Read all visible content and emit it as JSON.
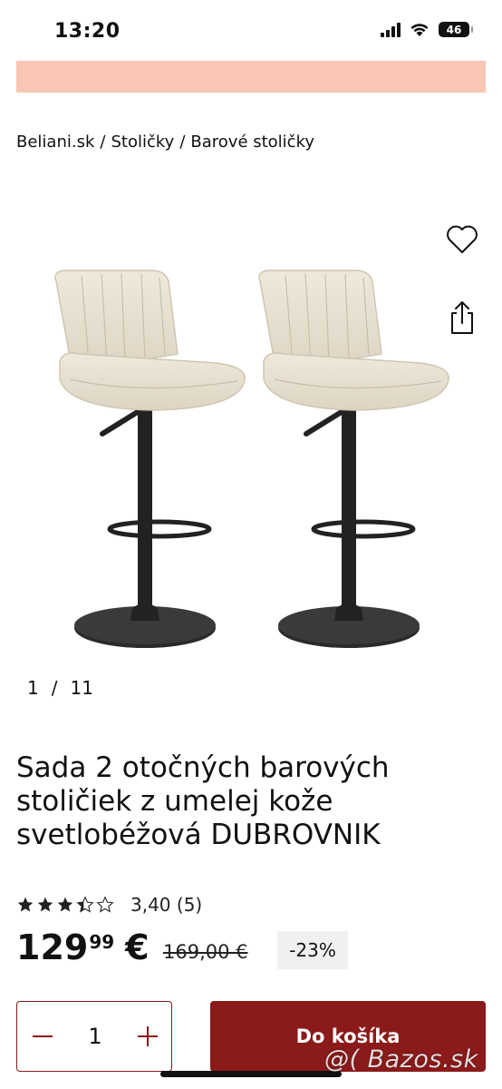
{
  "status_bar": {
    "time": "13:20",
    "battery": "46"
  },
  "breadcrumb": {
    "items": [
      "Beliani.sk",
      "Stoličky",
      "Barové stoličky"
    ],
    "separator": "/"
  },
  "gallery": {
    "current": "1",
    "separator": "/",
    "total": "11"
  },
  "icons": {
    "wishlist": "heart-icon",
    "share": "share-icon"
  },
  "product": {
    "title": "Sada 2 otočných barových stoličiek z umelej kože svetlobéžová DUBROVNIK",
    "rating": {
      "stars": 3.4,
      "max": 5,
      "text": "3,40 (5)"
    },
    "price_main": "129",
    "price_cents": "99",
    "currency": "€",
    "old_price": "169,00 €",
    "discount": "-23%"
  },
  "cart": {
    "quantity": "1",
    "add_label": "Do košíka"
  },
  "colors": {
    "banner": "#f9c6b3",
    "accent": "#8b1a1a",
    "discount_bg": "#f0f0f0"
  },
  "watermark": "@( Bazos.sk"
}
